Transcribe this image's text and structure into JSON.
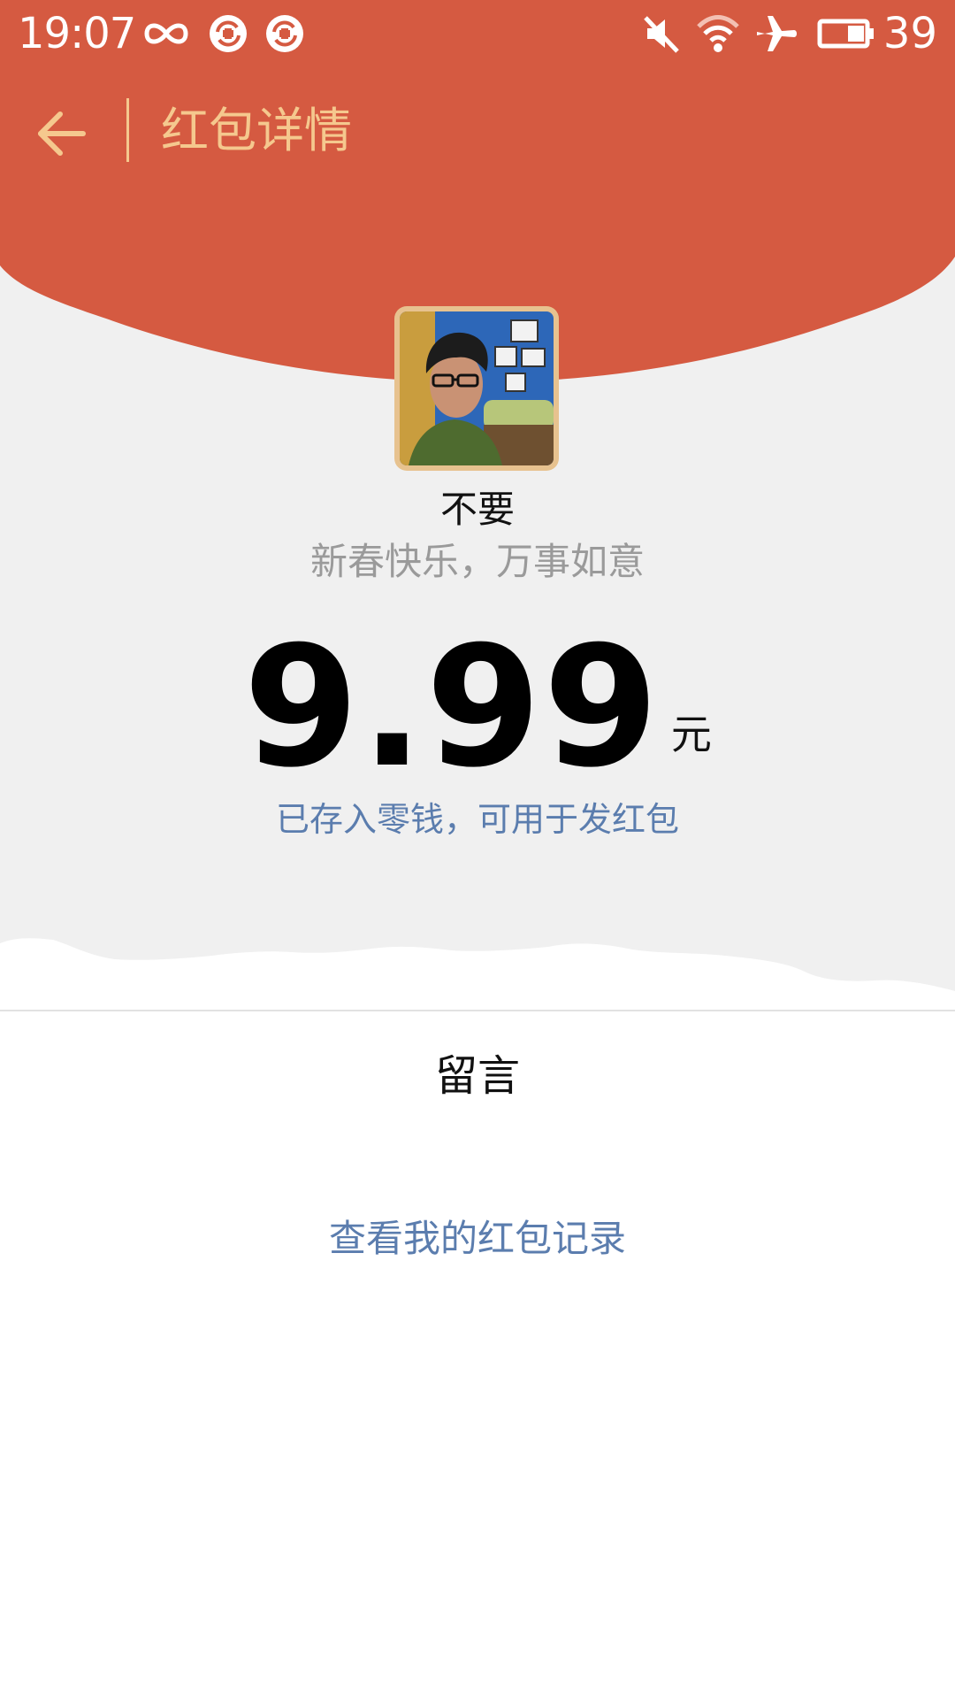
{
  "status_bar": {
    "time": "19:07",
    "battery_level": "39",
    "icons": [
      "infinity-icon",
      "sync-icon",
      "sync-icon",
      "mute-icon",
      "wifi-icon",
      "airplane-icon",
      "battery-icon"
    ]
  },
  "toolbar": {
    "back_icon": "arrow-left-icon",
    "title": "红包详情"
  },
  "packet": {
    "sender_name": "不要",
    "greeting": "新春快乐，万事如意",
    "amount": "9.99",
    "unit": "元",
    "deposit_note": "已存入零钱，可用于发红包"
  },
  "footer": {
    "message_label": "留言",
    "records_link": "查看我的红包记录"
  },
  "colors": {
    "header_red": "#d55a41",
    "gold_accent": "#f5c88e",
    "link_blue": "#5b7dae",
    "background_gray": "#f0f0f0"
  }
}
